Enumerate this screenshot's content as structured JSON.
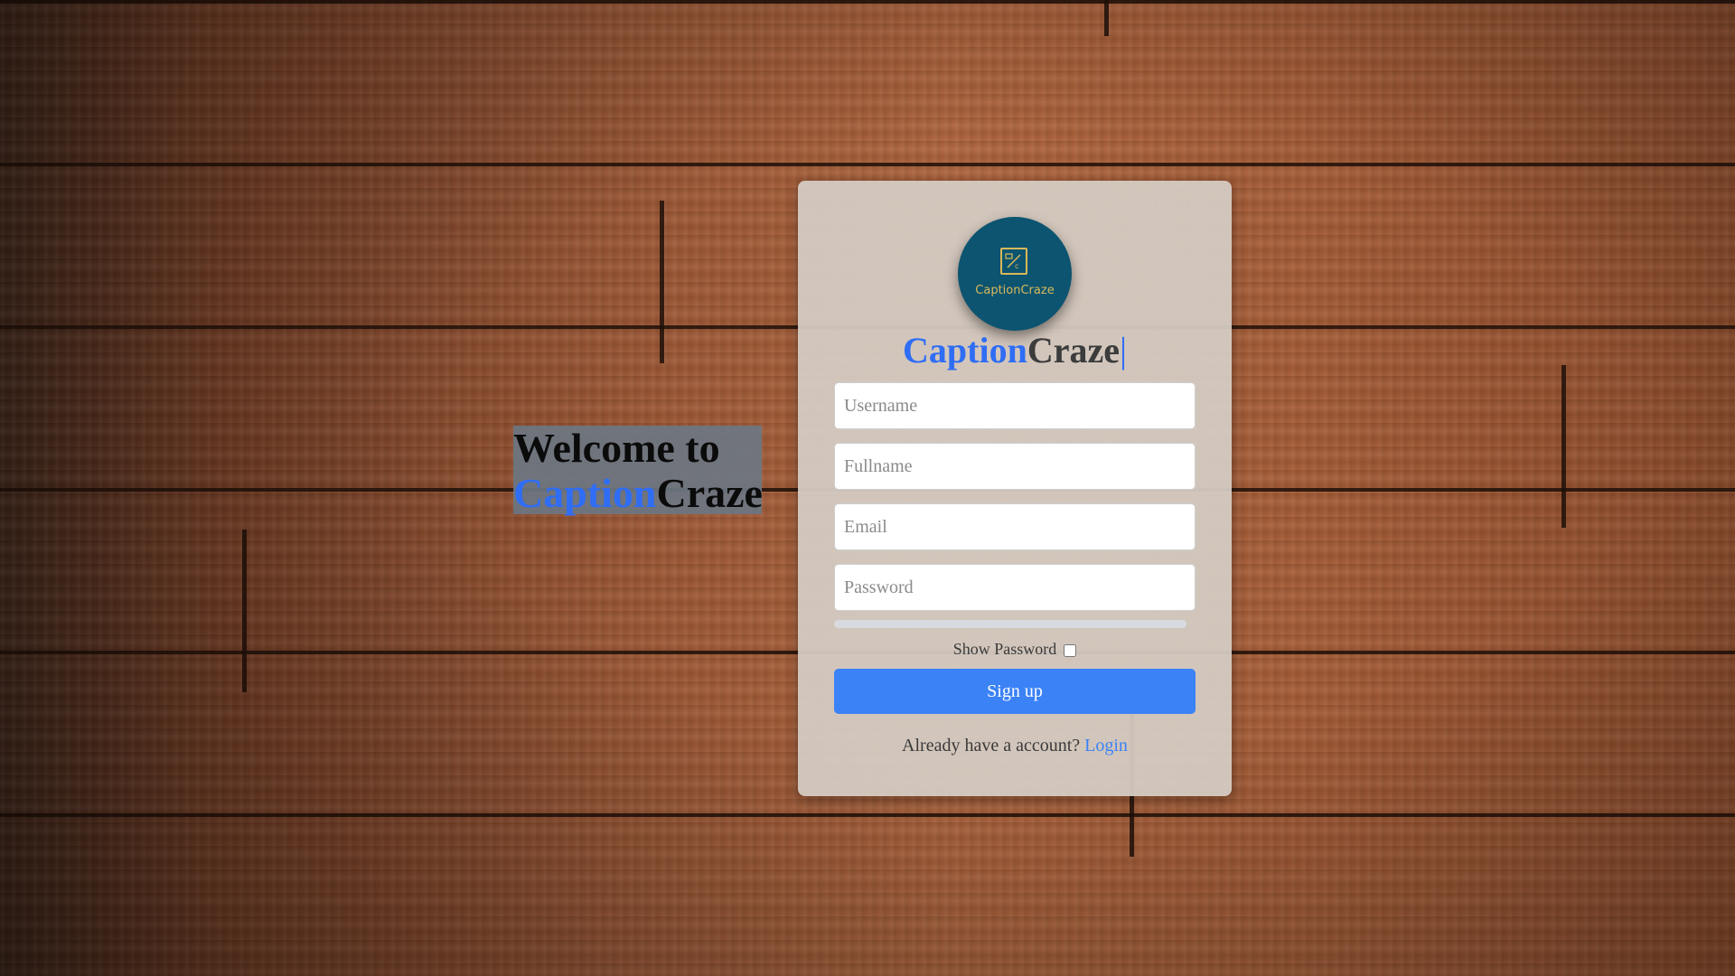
{
  "welcome": {
    "line1": "Welcome to",
    "brand_part1": "Caption",
    "brand_part2": "Craze"
  },
  "logo": {
    "text": "CaptionCraze"
  },
  "brand": {
    "part1": "Caption",
    "part2": "Craze",
    "cursor": "|"
  },
  "form": {
    "username_placeholder": "Username",
    "fullname_placeholder": "Fullname",
    "email_placeholder": "Email",
    "password_placeholder": "Password",
    "show_password_label": "Show Password",
    "signup_label": "Sign up",
    "login_prompt": "Already have a account?",
    "login_link": "Login"
  },
  "colors": {
    "accent": "#3b82f6",
    "brand_blue": "#2f6df5",
    "logo_bg": "#0c5470",
    "logo_gold": "#d9b85a"
  }
}
